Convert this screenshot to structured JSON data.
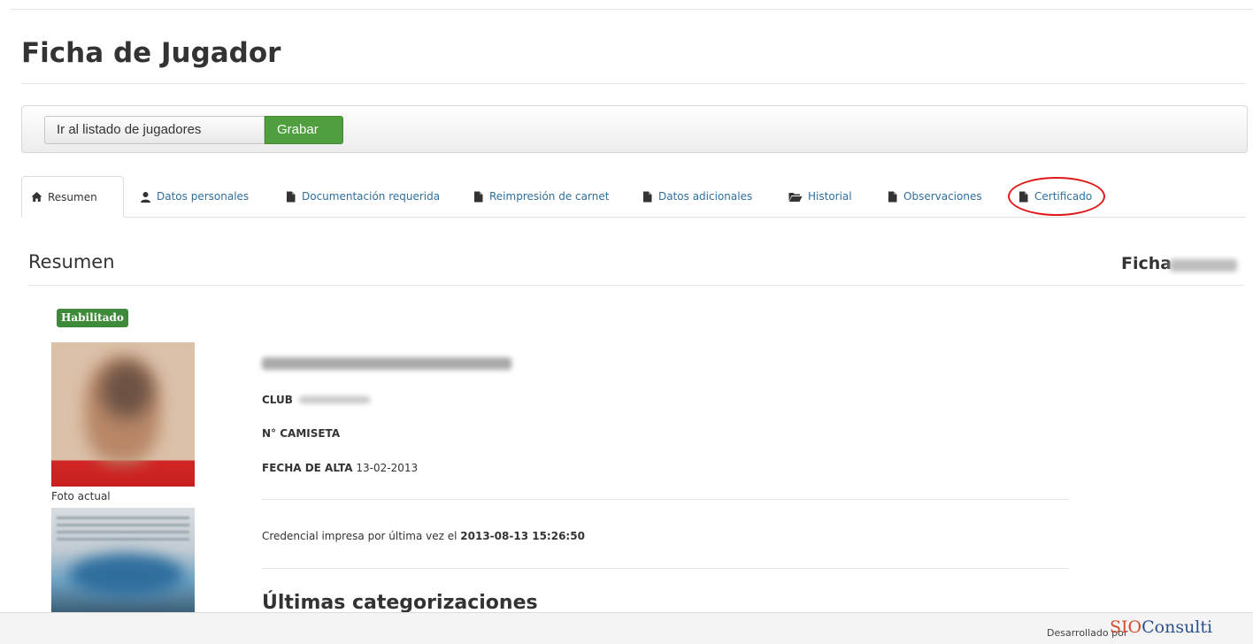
{
  "page": {
    "title": "Ficha de Jugador"
  },
  "toolbar": {
    "list_label": "Ir al listado de jugadores",
    "save_label": "Grabar"
  },
  "tabs": [
    {
      "label": "Resumen",
      "icon": "home-icon",
      "active": true
    },
    {
      "label": "Datos personales",
      "icon": "user-icon"
    },
    {
      "label": "Documentación requerida",
      "icon": "file-icon"
    },
    {
      "label": "Reimpresión de carnet",
      "icon": "file-icon"
    },
    {
      "label": "Datos adicionales",
      "icon": "file-icon"
    },
    {
      "label": "Historial",
      "icon": "folder-open-icon"
    },
    {
      "label": "Observaciones",
      "icon": "file-icon"
    },
    {
      "label": "Certificado",
      "icon": "file-icon"
    }
  ],
  "summary": {
    "title": "Resumen",
    "ficha_label": "Ficha",
    "status_badge": "Habilitado",
    "photo_caption": "Foto actual",
    "club_label": "CLUB",
    "shirt_label": "N° CAMISETA",
    "date_label": "FECHA DE ALTA",
    "date_value": "13-02-2013",
    "credential_text": "Credencial impresa por última vez el",
    "credential_date": "2013-08-13 15:26:50",
    "categories_title": "Últimas categorizaciones"
  },
  "footer": {
    "developed_by": "Desarrollado por",
    "logo_sio": "SIO",
    "logo_rest": "Consulti"
  },
  "colors": {
    "accent_green": "#4f9f3f",
    "badge_green": "#3f8a3a",
    "link_blue": "#2f6f9f",
    "highlight_red": "#e01818"
  }
}
